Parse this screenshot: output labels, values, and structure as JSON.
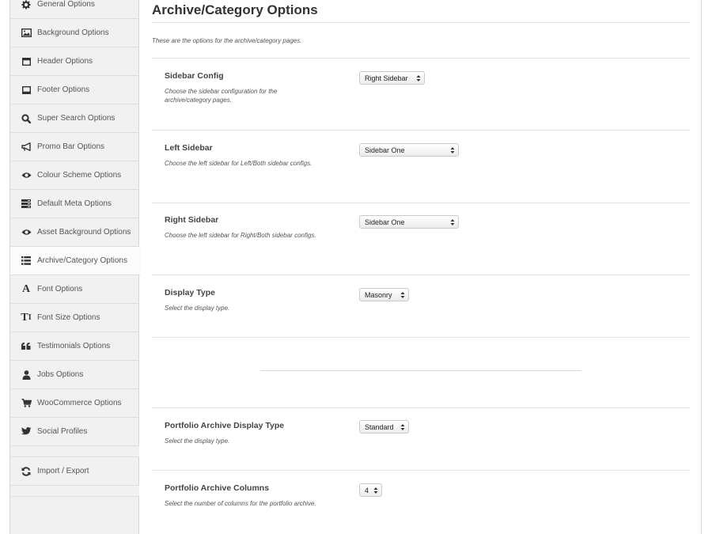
{
  "sidebar": {
    "items": [
      {
        "label": "General Options",
        "icon": "gear-icon"
      },
      {
        "label": "Background Options",
        "icon": "image-icon"
      },
      {
        "label": "Header Options",
        "icon": "header-icon"
      },
      {
        "label": "Footer Options",
        "icon": "footer-icon"
      },
      {
        "label": "Super Search Options",
        "icon": "search-icon"
      },
      {
        "label": "Promo Bar Options",
        "icon": "bullhorn-icon"
      },
      {
        "label": "Colour Scheme Options",
        "icon": "eye-icon"
      },
      {
        "label": "Default Meta Options",
        "icon": "meta-icon"
      },
      {
        "label": "Asset Background Options",
        "icon": "eye-icon"
      },
      {
        "label": "Archive/Category Options",
        "icon": "list-icon"
      },
      {
        "label": "Font Options",
        "icon": "font-icon"
      },
      {
        "label": "Font Size Options",
        "icon": "text-height-icon"
      },
      {
        "label": "Testimonials Options",
        "icon": "quote-icon"
      },
      {
        "label": "Jobs Options",
        "icon": "user-icon"
      },
      {
        "label": "WooCommerce Options",
        "icon": "cart-icon"
      },
      {
        "label": "Social Profiles",
        "icon": "twitter-icon"
      },
      {
        "label": "Import / Export",
        "icon": "refresh-icon"
      }
    ],
    "active": "Archive/Category Options"
  },
  "main": {
    "title": "Archive/Category Options",
    "description": "These are the options for the archive/category pages.",
    "options": [
      {
        "title": "Sidebar Config",
        "desc": "Choose the sidebar configuration for the archive/category pages.",
        "value": "Right Sidebar"
      },
      {
        "title": "Left Sidebar",
        "desc": "Choose the left sidebar for Left/Both sidebar configs.",
        "value": "Sidebar One"
      },
      {
        "title": "Right Sidebar",
        "desc": "Choose the left sidebar for Right/Both sidebar configs.",
        "value": "Sidebar One"
      },
      {
        "title": "Display Type",
        "desc": "Select the display type.",
        "value": "Masonry"
      },
      {
        "title": "Portfolio Archive Display Type",
        "desc": "Select the display type.",
        "value": "Standard"
      },
      {
        "title": "Portfolio Archive Columns",
        "desc": "Select the number of columns for the portfolio archive.",
        "value": "4"
      }
    ]
  },
  "colors": {
    "sidebar_bg": "#f1f1f1",
    "active_bg": "#fbfbfb",
    "text": "#333333"
  }
}
